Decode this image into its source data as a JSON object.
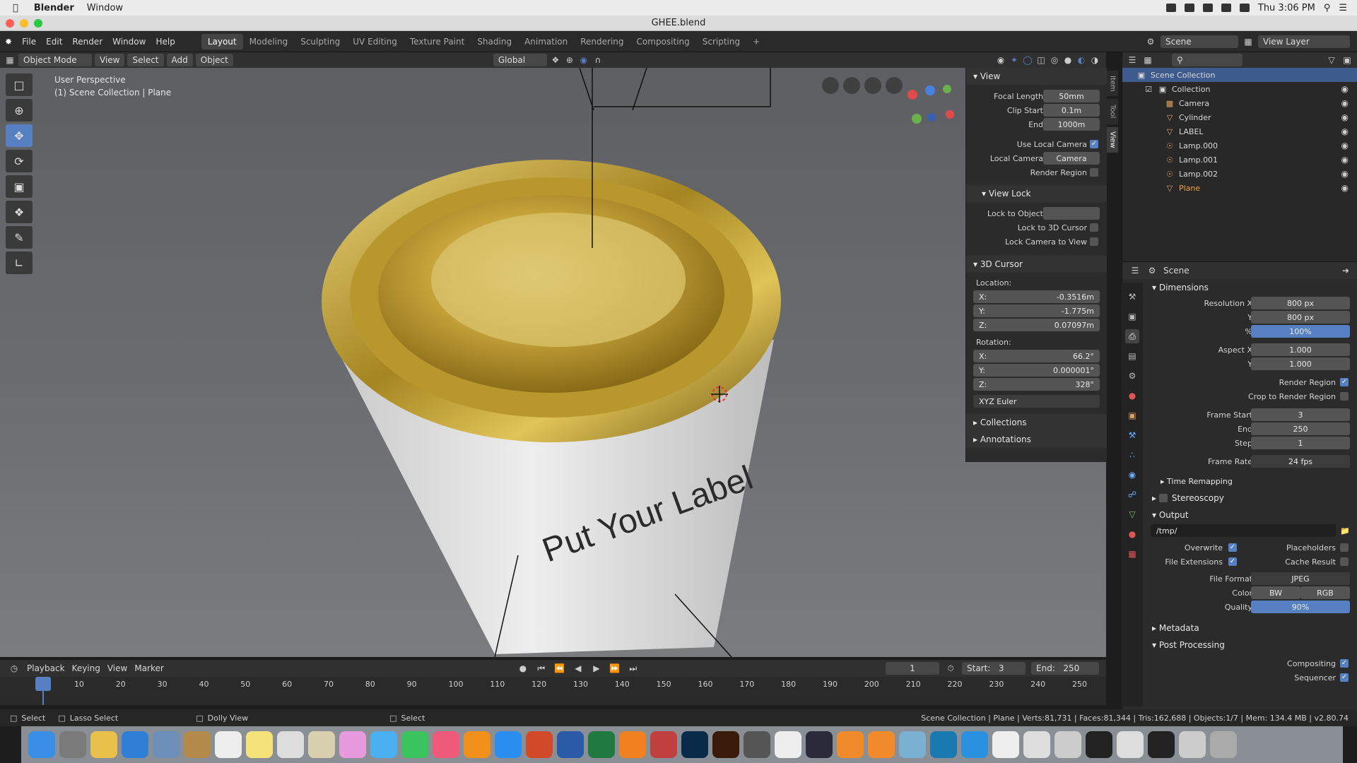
{
  "mac_menubar": {
    "app_name": "Blender",
    "menu": [
      "Window"
    ],
    "clock": "Thu 3:06 PM"
  },
  "window": {
    "title": "GHEE.blend"
  },
  "topbar": {
    "menus": [
      "File",
      "Edit",
      "Render",
      "Window",
      "Help"
    ],
    "workspaces": [
      "Layout",
      "Modeling",
      "Sculpting",
      "UV Editing",
      "Texture Paint",
      "Shading",
      "Animation",
      "Rendering",
      "Compositing",
      "Scripting"
    ],
    "scene_label": "Scene",
    "view_layer_label": "View Layer"
  },
  "viewport_header": {
    "mode": "Object Mode",
    "menus": [
      "View",
      "Select",
      "Add",
      "Object"
    ],
    "transform_orientation": "Global"
  },
  "viewport": {
    "perspective_text": "User Perspective",
    "collection_text": "(1) Scene Collection | Plane",
    "label_text": "Put Your Label"
  },
  "npanel": {
    "tabs": [
      "Item",
      "Tool",
      "View"
    ],
    "view_section": "View",
    "focal_length_label": "Focal Length",
    "focal_length": "50mm",
    "clip_start_label": "Clip Start",
    "clip_start": "0.1m",
    "end_label": "End",
    "end": "1000m",
    "use_local_camera": "Use Local Camera",
    "local_camera_label": "Local Camera",
    "local_camera": "Camera",
    "render_region": "Render Region",
    "view_lock_section": "View Lock",
    "lock_to_object": "Lock to Object",
    "lock_to_3d_cursor": "Lock to 3D Cursor",
    "lock_camera_to_view": "Lock Camera to View",
    "cursor_section": "3D Cursor",
    "location_label": "Location:",
    "loc_x": "-0.3516m",
    "loc_y": "-1.775m",
    "loc_z": "0.07097m",
    "rotation_label": "Rotation:",
    "rot_x": "66.2°",
    "rot_y": "0.000001°",
    "rot_z": "328°",
    "rotation_mode": "XYZ Euler",
    "collections": "Collections",
    "annotations": "Annotations"
  },
  "outliner": {
    "root": "Scene Collection",
    "collection": "Collection",
    "items": [
      "Camera",
      "Cylinder",
      "LABEL",
      "Lamp.000",
      "Lamp.001",
      "Lamp.002",
      "Plane"
    ]
  },
  "properties": {
    "scene": "Scene",
    "dimensions": "Dimensions",
    "res_x_label": "Resolution X",
    "res_x": "800 px",
    "res_y_label": "Y",
    "res_y": "800 px",
    "pct_label": "%",
    "pct": "100%",
    "aspect_x_label": "Aspect X",
    "aspect_x": "1.000",
    "aspect_y_label": "Y",
    "aspect_y": "1.000",
    "render_region": "Render Region",
    "crop": "Crop to Render Region",
    "frame_start_label": "Frame Start",
    "frame_start": "3",
    "frame_end_label": "End",
    "frame_end": "250",
    "step_label": "Step",
    "step": "1",
    "frame_rate_label": "Frame Rate",
    "frame_rate": "24 fps",
    "time_remapping": "Time Remapping",
    "stereoscopy": "Stereoscopy",
    "output": "Output",
    "output_path": "/tmp/",
    "overwrite": "Overwrite",
    "placeholders": "Placeholders",
    "file_extensions": "File Extensions",
    "cache_result": "Cache Result",
    "file_format_label": "File Format",
    "file_format": "JPEG",
    "color_label": "Color",
    "color_bw": "BW",
    "color_rgb": "RGB",
    "quality_label": "Quality",
    "quality": "90%",
    "metadata": "Metadata",
    "post_processing": "Post Processing",
    "compositing": "Compositing",
    "sequencer": "Sequencer"
  },
  "timeline": {
    "menus": [
      "Playback",
      "Keying",
      "View",
      "Marker"
    ],
    "current_frame": "1",
    "start_label": "Start:",
    "start": "3",
    "end_label": "End:",
    "end": "250",
    "ticks": [
      "1",
      "10",
      "20",
      "30",
      "40",
      "50",
      "60",
      "70",
      "80",
      "90",
      "100",
      "110",
      "120",
      "130",
      "140",
      "150",
      "160",
      "170",
      "180",
      "190",
      "200",
      "210",
      "220",
      "230",
      "240",
      "250"
    ]
  },
  "statusbar": {
    "select": "Select",
    "lasso": "Lasso Select",
    "dolly": "Dolly View",
    "select2": "Select",
    "stats": "Scene Collection | Plane | Verts:81,731 | Faces:81,344 | Tris:162,688 | Objects:1/7 | Mem: 134.4 MB | v2.80.74"
  },
  "colors": {
    "accent": "#5680c2",
    "gold": "#c9a53a",
    "selected_item": "#f0a030"
  }
}
